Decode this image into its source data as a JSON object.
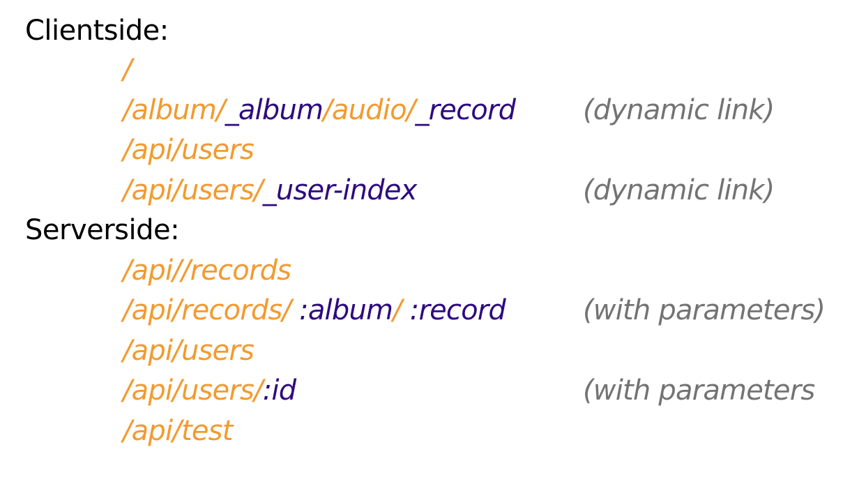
{
  "headings": {
    "clientside": "Clientside:",
    "serverside": "Serverside:"
  },
  "colors": {
    "static_segment": "#f39a2e",
    "param_segment": "#2e0a80",
    "note": "#737373",
    "heading": "#000000"
  },
  "clientside": [
    {
      "segments": [
        {
          "text": "/",
          "kind": "static"
        }
      ],
      "note": ""
    },
    {
      "segments": [
        {
          "text": "/album/",
          "kind": "static"
        },
        {
          "text": "_album",
          "kind": "param"
        },
        {
          "text": "/audio/",
          "kind": "static"
        },
        {
          "text": "_record",
          "kind": "param"
        }
      ],
      "note": "(dynamic link)"
    },
    {
      "segments": [
        {
          "text": "/api/users",
          "kind": "static"
        }
      ],
      "note": ""
    },
    {
      "segments": [
        {
          "text": "/api/users/",
          "kind": "static"
        },
        {
          "text": "_user-index",
          "kind": "param"
        }
      ],
      "note": "(dynamic link)"
    }
  ],
  "serverside": [
    {
      "segments": [
        {
          "text": "/api//records",
          "kind": "static"
        }
      ],
      "note": ""
    },
    {
      "segments": [
        {
          "text": "/api/records/",
          "kind": "static"
        },
        {
          "text": " :album",
          "kind": "param"
        },
        {
          "text": "/",
          "kind": "static"
        },
        {
          "text": " :record",
          "kind": "param"
        }
      ],
      "note": "(with parameters)"
    },
    {
      "segments": [
        {
          "text": "/api/users",
          "kind": "static"
        }
      ],
      "note": ""
    },
    {
      "segments": [
        {
          "text": "/api/users/",
          "kind": "static"
        },
        {
          "text": ":id",
          "kind": "param"
        }
      ],
      "note": "(with parameters"
    },
    {
      "segments": [
        {
          "text": "/api/test",
          "kind": "static"
        }
      ],
      "note": ""
    }
  ]
}
